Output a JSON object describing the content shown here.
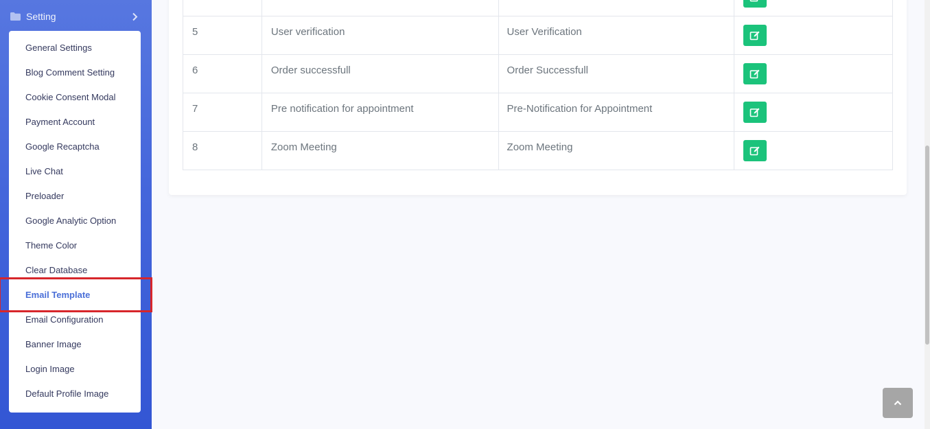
{
  "sidebar": {
    "section_label": "Setting",
    "folder_icon": "folder-icon",
    "chevron_icon": "chevron-right-icon",
    "items": [
      {
        "label": "General Settings"
      },
      {
        "label": "Blog Comment Setting"
      },
      {
        "label": "Cookie Consent Modal"
      },
      {
        "label": "Payment Account"
      },
      {
        "label": "Google Recaptcha"
      },
      {
        "label": "Live Chat"
      },
      {
        "label": "Preloader"
      },
      {
        "label": "Google Analytic Option"
      },
      {
        "label": "Theme Color"
      },
      {
        "label": "Clear Database"
      },
      {
        "label": "Email Template",
        "active": true
      },
      {
        "label": "Email Configuration"
      },
      {
        "label": "Banner Image"
      },
      {
        "label": "Login Image"
      },
      {
        "label": "Default Profile Image"
      }
    ]
  },
  "table": {
    "rows": [
      {
        "no": "",
        "name": "",
        "subject": ""
      },
      {
        "no": "5",
        "name": "User verification",
        "subject": "User Verification"
      },
      {
        "no": "6",
        "name": "Order successfull",
        "subject": "Order Successfull"
      },
      {
        "no": "7",
        "name": "Pre notification for appointment",
        "subject": "Pre-Notification for Appointment"
      },
      {
        "no": "8",
        "name": "Zoom Meeting",
        "subject": "Zoom Meeting"
      }
    ],
    "action_icon": "edit-icon"
  },
  "colors": {
    "sidebar_accent": "#4466db",
    "active_item": "#4a6fd8",
    "edit_button": "#1bc37b",
    "highlight_border": "#d7262b"
  },
  "back_to_top_icon": "chevron-up-icon"
}
